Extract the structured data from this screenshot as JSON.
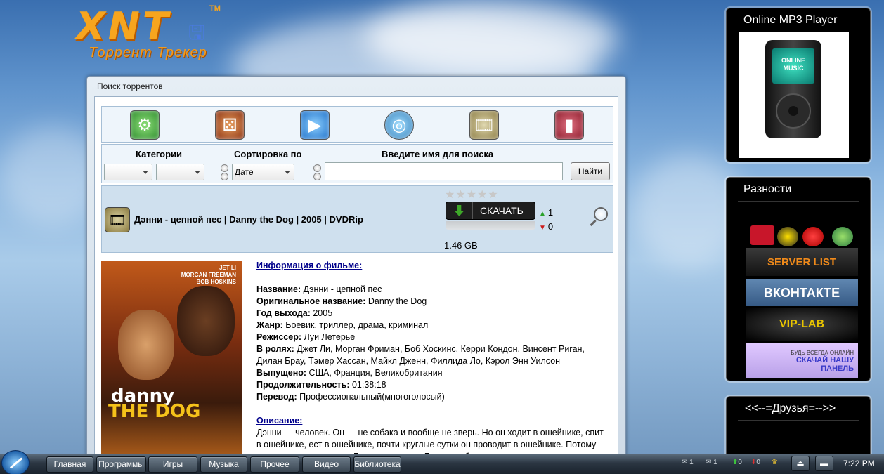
{
  "logo": {
    "title": "XNT",
    "tm": "TM",
    "subtitle": "Торрент Трекер"
  },
  "window": {
    "title": "Поиск торрентов",
    "category_icons": [
      "settings-icon",
      "dice-icon",
      "media-player-icon",
      "disc-icon",
      "film-reel-icon",
      "book-icon"
    ],
    "search": {
      "categories_label": "Категории",
      "sort_label": "Сортировка по",
      "search_label": "Введите имя для поиска",
      "category_value_1": "",
      "category_value_2": "",
      "sort_value": "Дате",
      "query_value": "",
      "find_button": "Найти"
    },
    "torrent": {
      "title": "Дэнни - цепной пес | Danny the Dog | 2005 | DVDRip",
      "stars": "★★★★★",
      "rating_stars": 0,
      "download_label": "СКАЧАТЬ",
      "seeders": "1",
      "leechers": "0",
      "size": "1.46 GB"
    },
    "poster": {
      "cast": [
        "JET LI",
        "MORGAN FREEMAN",
        "BOB HOSKINS"
      ],
      "title_line1": "danny",
      "title_line2": "THE DOG"
    },
    "info": {
      "heading": "Информация о фильме:",
      "name_label": "Название:",
      "name_value": "Дэнни - цепной пес",
      "orig_label": "Оригинальное название:",
      "orig_value": "Danny the Dog",
      "year_label": "Год выхода:",
      "year_value": "2005",
      "genre_label": "Жанр:",
      "genre_value": "Боевик, триллер, драма, криминал",
      "director_label": "Режиссер:",
      "director_value": "Луи Летерье",
      "cast_label": "В ролях:",
      "cast_value": "Джет Ли, Морган Фриман, Боб Хоскинс, Керри Кондон, Винсент Риган, Дилан Брау, Тэмер Хассан, Майкл Дженн, Филлида Ло, Кэрол Энн Уилсон",
      "released_label": "Выпущено:",
      "released_value": "США, Франция, Великобритания",
      "duration_label": "Продолжительность:",
      "duration_value": "01:38:18",
      "translation_label": "Перевод:",
      "translation_value": "Профессиональный(многоголосый)",
      "desc_heading": "Описание:",
      "desc_text": "Дэнни — человек. Он — не собака и вообще не зверь. Но он ходит в ошейнике, спит в ошейнике, ест в ошейнике, почти круглые сутки он проводит в ошейнике. Потому что таким его воспитал Барт, гангстер из Глазго, собиратель долгов, не"
    }
  },
  "widgets": {
    "player": {
      "title": "Online MP3 Player",
      "screen_text": "ONLINE MUSIC"
    },
    "misc": {
      "title": "Разности",
      "banners": [
        "SERVER LIST",
        "ВКОНТАКТЕ",
        "VIP-LAB",
        "БУДЬ ВСЕГДА ОНЛАЙН",
        "СКАЧАЙ НАШУ ПАНЕЛЬ"
      ]
    },
    "friends": {
      "title": "<<--=Друзья=-->>"
    }
  },
  "taskbar": {
    "buttons": [
      "Главная",
      "Программы",
      "Игры",
      "Музыка",
      "Прочее",
      "Видео",
      "Библиотека"
    ],
    "tray": {
      "mail_count_1": "1",
      "mail_count_2": "1",
      "up_count": "0",
      "down_count": "0"
    },
    "clock": "7:22 PM"
  }
}
